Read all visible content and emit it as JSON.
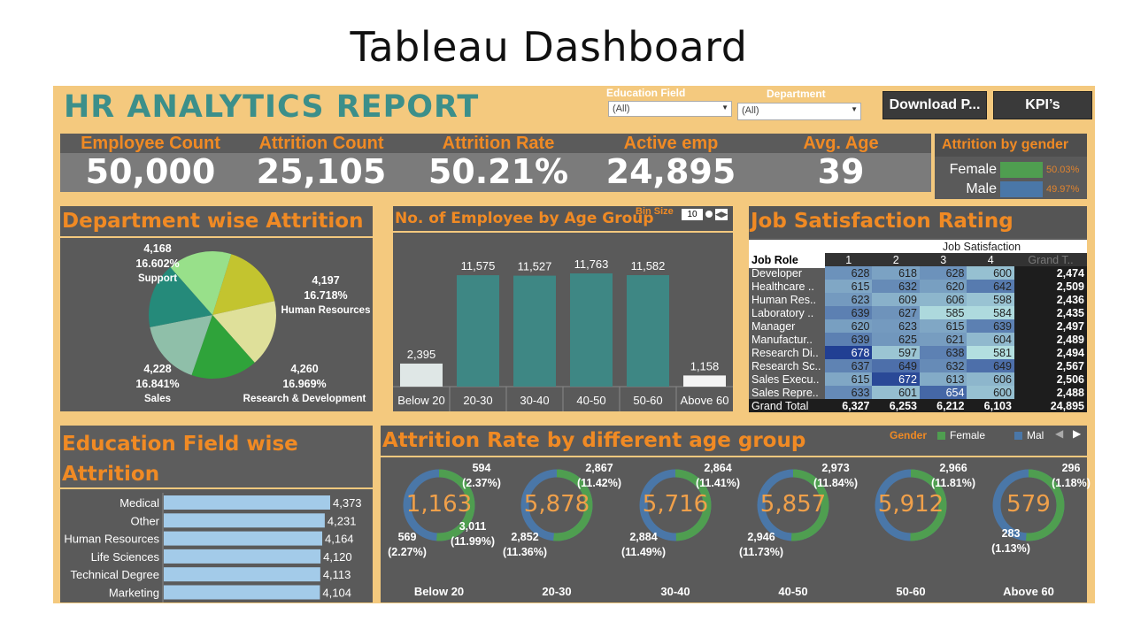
{
  "slide_title": "Tableau Dashboard",
  "report_title": "HR ANALYTICS REPORT",
  "filters": {
    "education_label": "Education Field",
    "education_value": "(All)",
    "department_label": "Department",
    "department_value": "(All)"
  },
  "buttons": {
    "download": "Download P...",
    "kpis": "KPI’s"
  },
  "kpis": [
    {
      "label": "Employee Count",
      "value": "50,000"
    },
    {
      "label": "Attrition Count",
      "value": "25,105"
    },
    {
      "label": "Attrition Rate",
      "value": "50.21%"
    },
    {
      "label": "Active emp",
      "value": "24,895"
    },
    {
      "label": "Avg. Age",
      "value": "39"
    }
  ],
  "gender_panel": {
    "title": "Attrition by gender",
    "rows": [
      {
        "label": "Female",
        "pct": "50.03%",
        "color": "#4f9e50"
      },
      {
        "label": "Male",
        "pct": "49.97%",
        "color": "#4a77a8"
      }
    ]
  },
  "dept_panel": {
    "title": "Department wise Attrition",
    "labels": [
      {
        "count": "4,168",
        "pct": "16.602%",
        "name": "Support"
      },
      {
        "count": "4,197",
        "pct": "16.718%",
        "name": "Human Resources"
      },
      {
        "count": "4,228",
        "pct": "16.841%",
        "name": "Sales"
      },
      {
        "count": "4,260",
        "pct": "16.969%",
        "name": "Research & Development"
      }
    ]
  },
  "age_panel": {
    "title": "No. of Employee by Age Group",
    "bin_label": "Bin Size",
    "bin_value": "10"
  },
  "job_panel": {
    "title": "Job Satisfaction Rating",
    "header_top": "Job Satisfaction",
    "row_header": "Job Role",
    "cols": [
      "1",
      "2",
      "3",
      "4",
      "Grand T.."
    ],
    "rows": [
      {
        "role": "Developer",
        "vals": [
          "628",
          "618",
          "628",
          "600"
        ],
        "total": "2,474"
      },
      {
        "role": "Healthcare ..",
        "vals": [
          "615",
          "632",
          "620",
          "642"
        ],
        "total": "2,509"
      },
      {
        "role": "Human Res..",
        "vals": [
          "623",
          "609",
          "606",
          "598"
        ],
        "total": "2,436"
      },
      {
        "role": "Laboratory ..",
        "vals": [
          "639",
          "627",
          "585",
          "584"
        ],
        "total": "2,435"
      },
      {
        "role": "Manager",
        "vals": [
          "620",
          "623",
          "615",
          "639"
        ],
        "total": "2,497"
      },
      {
        "role": "Manufactur..",
        "vals": [
          "639",
          "625",
          "621",
          "604"
        ],
        "total": "2,489"
      },
      {
        "role": "Research Di..",
        "vals": [
          "678",
          "597",
          "638",
          "581"
        ],
        "total": "2,494"
      },
      {
        "role": "Research Sc..",
        "vals": [
          "637",
          "649",
          "632",
          "649"
        ],
        "total": "2,567"
      },
      {
        "role": "Sales Execu..",
        "vals": [
          "615",
          "672",
          "613",
          "606"
        ],
        "total": "2,506"
      },
      {
        "role": "Sales Repre..",
        "vals": [
          "633",
          "601",
          "654",
          "600"
        ],
        "total": "2,488"
      }
    ],
    "grand_total": {
      "label": "Grand Total",
      "vals": [
        "6,327",
        "6,253",
        "6,212",
        "6,103"
      ],
      "total": "24,895"
    }
  },
  "edu_panel": {
    "title_line1": "Education Field wise",
    "title_line2": "Attrition"
  },
  "rate_panel": {
    "title": "Attrition Rate by different age group",
    "legend_title": "Gender",
    "legend_female": "Female",
    "legend_male": "Mal",
    "groups": [
      {
        "age": "Below 20",
        "center": "1,163",
        "a_count": "594",
        "a_pct": "(2.37%)",
        "b_count": "3,011",
        "b_pct": "(11.99%)",
        "c_count": "569",
        "c_pct": "(2.27%)"
      },
      {
        "age": "20-30",
        "center": "5,878",
        "a_count": "2,867",
        "a_pct": "(11.42%)",
        "c_count": "2,852",
        "c_pct": "(11.36%)"
      },
      {
        "age": "30-40",
        "center": "5,716",
        "a_count": "2,864",
        "a_pct": "(11.41%)",
        "c_count": "2,884",
        "c_pct": "(11.49%)"
      },
      {
        "age": "40-50",
        "center": "5,857",
        "a_count": "2,973",
        "a_pct": "(11.84%)",
        "c_count": "2,946",
        "c_pct": "(11.73%)"
      },
      {
        "age": "50-60",
        "center": "5,912",
        "a_count": "2,966",
        "a_pct": "(11.81%)",
        "c_count": "",
        "c_pct": ""
      },
      {
        "age": "Above 60",
        "center": "579",
        "a_count": "296",
        "a_pct": "(1.18%)",
        "c_count": "283",
        "c_pct": "(1.13%)"
      }
    ]
  },
  "chart_data": [
    {
      "type": "bar",
      "title": "No. of Employee by Age Group",
      "categories": [
        "Below 20",
        "20-30",
        "30-40",
        "40-50",
        "50-60",
        "Above 60"
      ],
      "values": [
        2395,
        11575,
        11527,
        11763,
        11582,
        1158
      ],
      "data_labels": [
        "2,395",
        "11,575",
        "11,527",
        "11,763",
        "11,582",
        "1,158"
      ],
      "colors": [
        "#dfe7e6",
        "#3e8784",
        "#3e8784",
        "#3e8784",
        "#3e8784",
        "#f4f4f4"
      ],
      "ylim": [
        0,
        12500
      ]
    },
    {
      "type": "pie",
      "title": "Department wise Attrition",
      "slices": [
        {
          "name": "Human Resources",
          "value": 4197,
          "color": "#c3c42f"
        },
        {
          "name": "Research & Development",
          "value": 4260,
          "color": "#dfe09a"
        },
        {
          "name": "Sales",
          "value": 4228,
          "color": "#2fa33a"
        },
        {
          "name": "Support",
          "value": 4168,
          "color": "#8fbfa9"
        },
        {
          "name": "",
          "value": 4168,
          "color": "#258a7a"
        },
        {
          "name": "",
          "value": 4084,
          "color": "#98e08a"
        }
      ]
    },
    {
      "type": "bar",
      "title": "Education Field wise Attrition",
      "categories": [
        "Medical",
        "Other",
        "Human Resources",
        "Life Sciences",
        "Technical Degree",
        "Marketing"
      ],
      "values": [
        4373,
        4231,
        4164,
        4120,
        4113,
        4104
      ],
      "data_labels": [
        "4,373",
        "4,231",
        "4,164",
        "4,120",
        "4,113",
        "4,104"
      ],
      "color": "#a3cbe9",
      "orientation": "horizontal"
    },
    {
      "type": "pie",
      "title": "Attrition Rate by different age group",
      "series": [
        {
          "name": "Female",
          "color": "#4f9e50"
        },
        {
          "name": "Male",
          "color": "#4a77a8"
        }
      ],
      "groups": [
        {
          "age": "Below 20",
          "female": 594,
          "male": 569
        },
        {
          "age": "20-30",
          "female": 3026,
          "male": 2852
        },
        {
          "age": "30-40",
          "female": 2832,
          "male": 2884
        },
        {
          "age": "40-50",
          "female": 2973,
          "male": 2884
        },
        {
          "age": "50-60",
          "female": 2966,
          "male": 2946
        },
        {
          "age": "Above 60",
          "female": 296,
          "male": 283
        }
      ]
    }
  ]
}
